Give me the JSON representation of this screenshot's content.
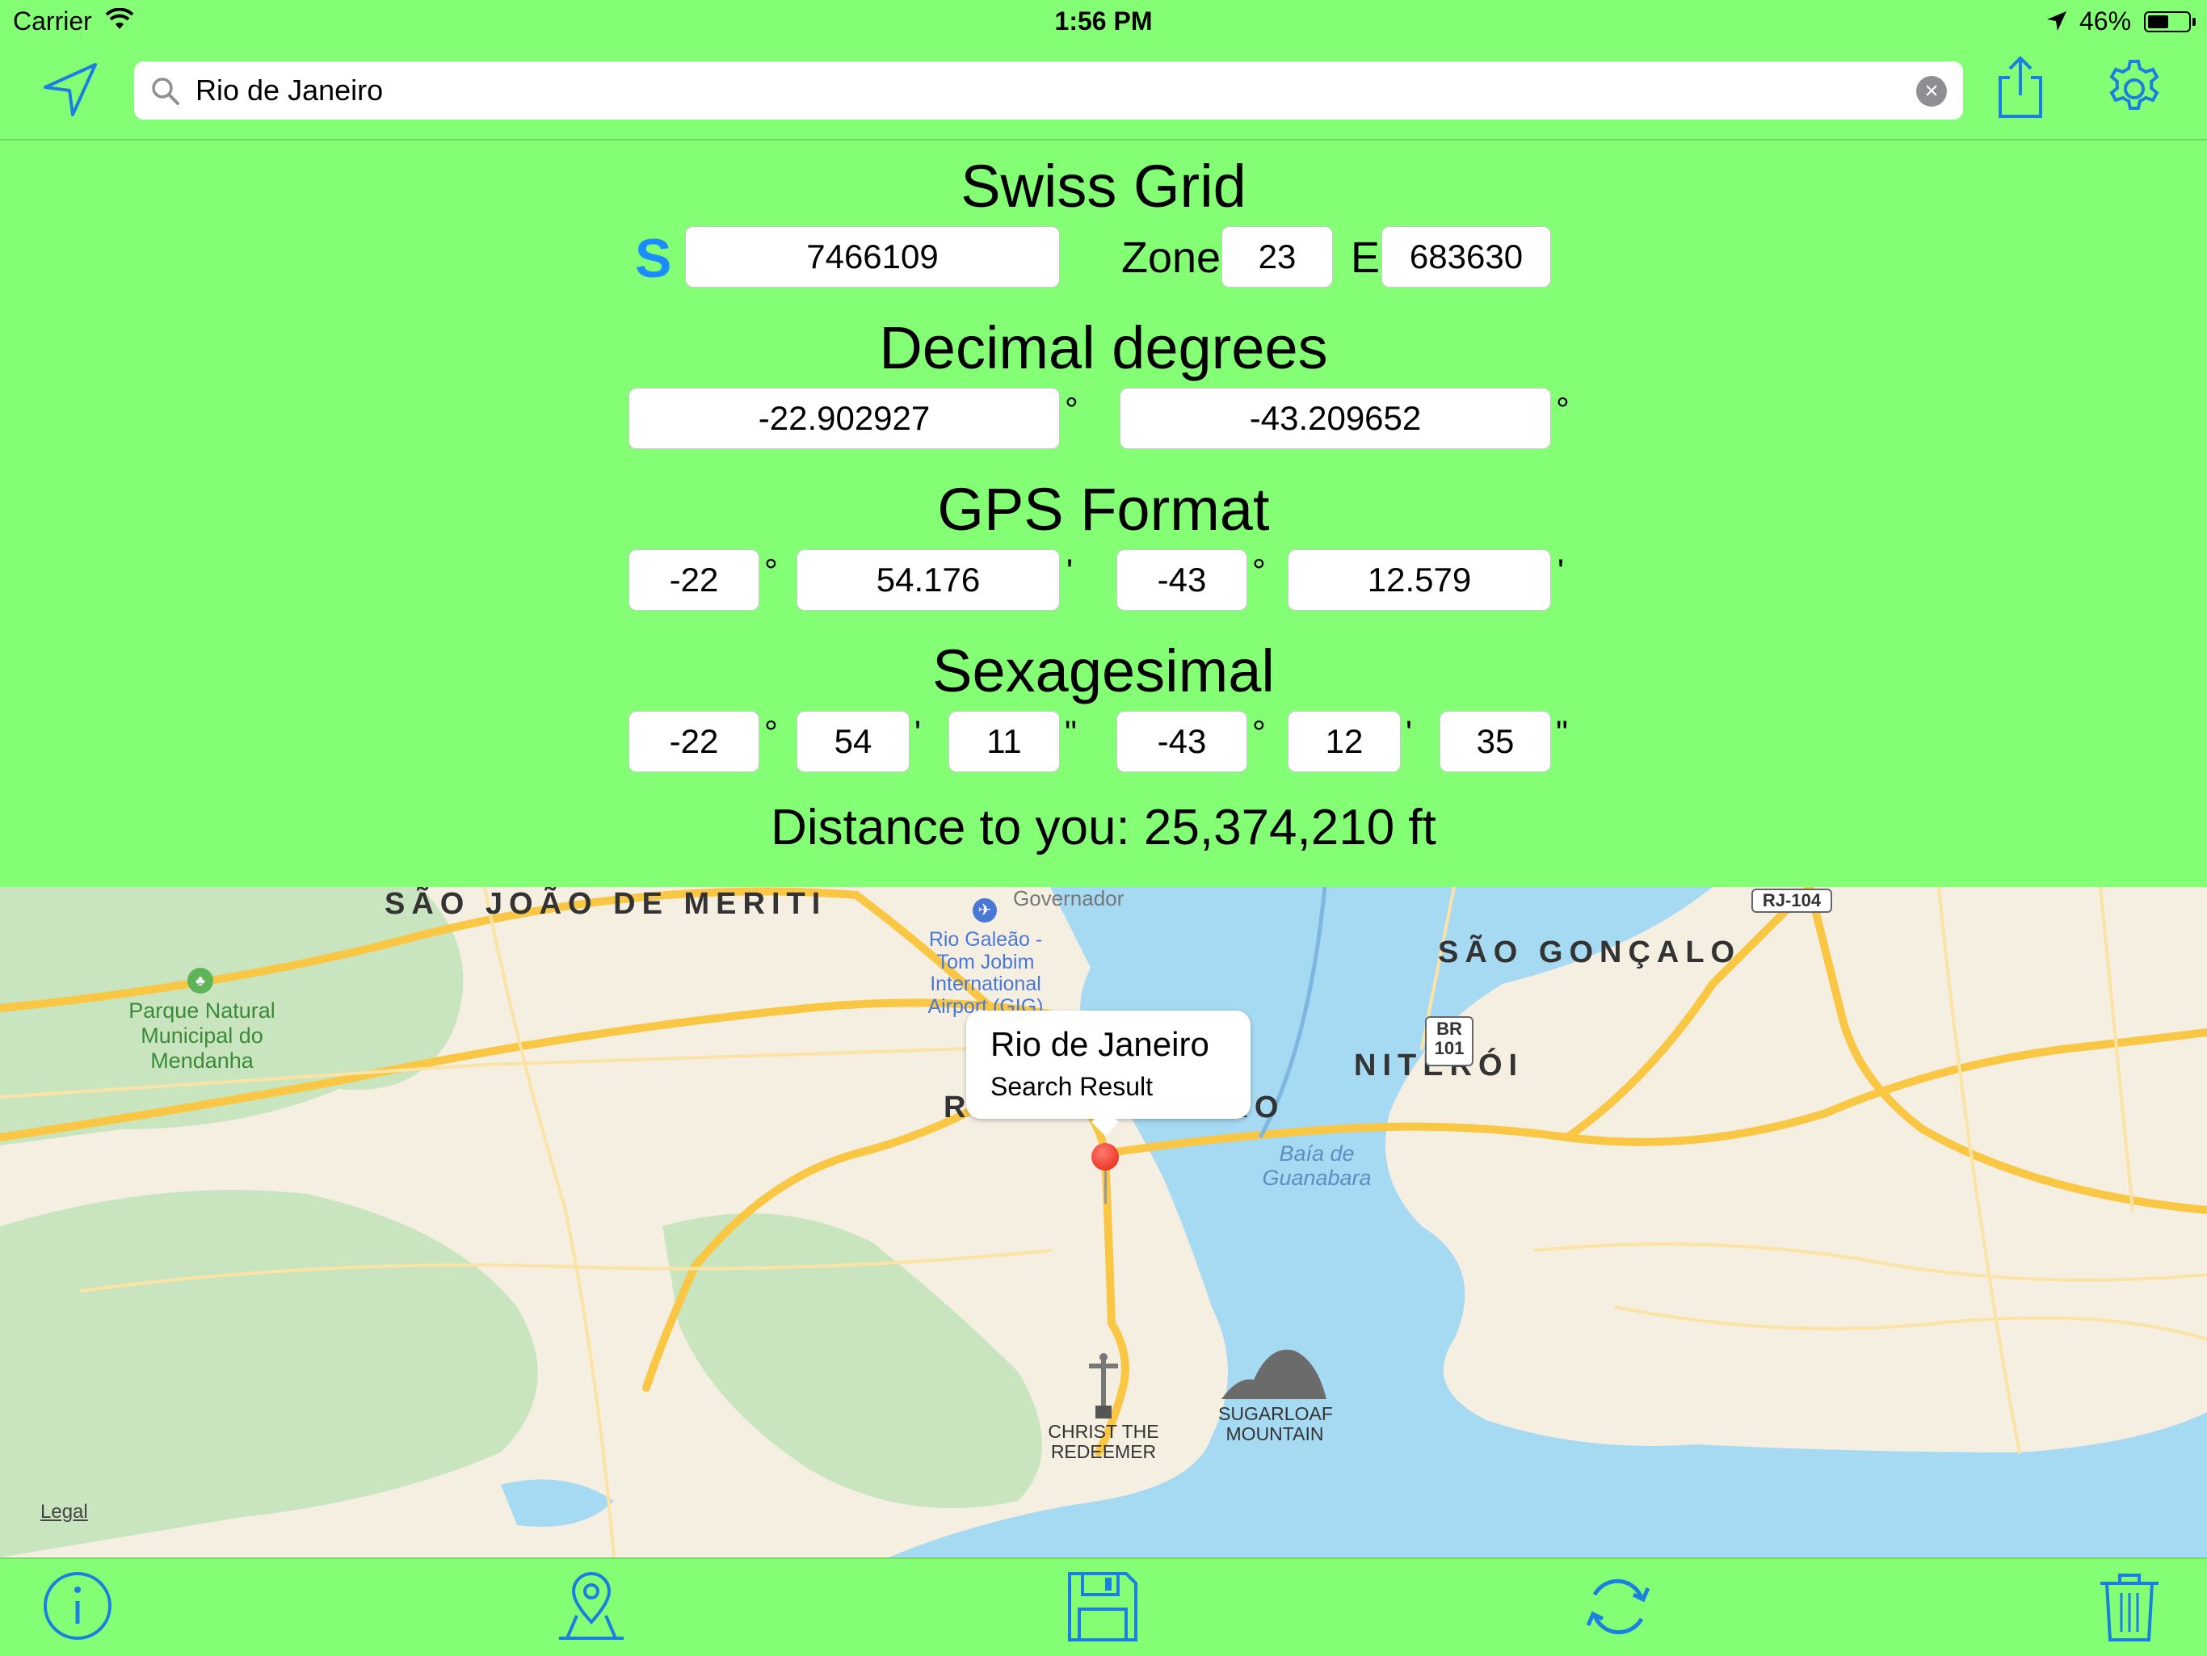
{
  "status_bar": {
    "carrier": "Carrier",
    "time": "1:56 PM",
    "battery": "46%",
    "battery_level": 0.46
  },
  "nav": {
    "search": {
      "value": "Rio de Janeiro"
    },
    "icons": [
      "location-arrow-icon",
      "search-icon",
      "clear-icon",
      "share-icon",
      "gear-icon"
    ],
    "accent": "#1a7fe0"
  },
  "swiss_grid": {
    "title": "Swiss Grid",
    "hemisphere": "S",
    "northing": "7466109",
    "zone_label": "Zone",
    "zone": "23",
    "easting_label": "E",
    "easting": "683630"
  },
  "decimal": {
    "title": "Decimal degrees",
    "lat": "-22.902927",
    "lon": "-43.209652",
    "degree_symbol": "°"
  },
  "gps": {
    "title": "GPS Format",
    "lat_deg": "-22",
    "lat_min": "54.176",
    "lon_deg": "-43",
    "lon_min": "12.579",
    "deg_symbol": "°",
    "min_symbol": "'"
  },
  "sexagesimal": {
    "title": "Sexagesimal",
    "lat_deg": "-22",
    "lat_min": "54",
    "lat_sec": "11",
    "lon_deg": "-43",
    "lon_min": "12",
    "lon_sec": "35",
    "deg_symbol": "°",
    "min_symbol": "'",
    "sec_symbol": "\""
  },
  "distance": "Distance to you: 25,374,210 ft",
  "map": {
    "labels": {
      "sao_joao": "SÃO JOÃO DE MERITI",
      "governador": "Governador",
      "airport": "Rio Galeão - Tom Jobim International Airport (GIG)",
      "sao_goncalo": "SÃO GONÇALO",
      "park": "Parque Natural Municipal do Mendanha",
      "niteroi": "NITERÓI",
      "rio": "RIO DE JANEIRO",
      "bay": "Baía de Guanabara",
      "christ": "CHRIST THE REDEEMER",
      "sugarloaf": "SUGARLOAF MOUNTAIN",
      "rj104": "RJ-104",
      "br101_a": "BR",
      "br101_b": "101",
      "legal": "Legal"
    },
    "callout": {
      "title": "Rio de Janeiro",
      "subtitle": "Search Result"
    },
    "colors": {
      "land": "#f5efe1",
      "water": "#a6d9f2",
      "park": "#c9e5bf",
      "road": "#f9c744",
      "pin": "#e41f12"
    }
  },
  "toolbar": {
    "icons": [
      "info-icon",
      "map-pin-icon",
      "save-icon",
      "refresh-icon",
      "trash-icon"
    ]
  },
  "background": "#84fe74"
}
